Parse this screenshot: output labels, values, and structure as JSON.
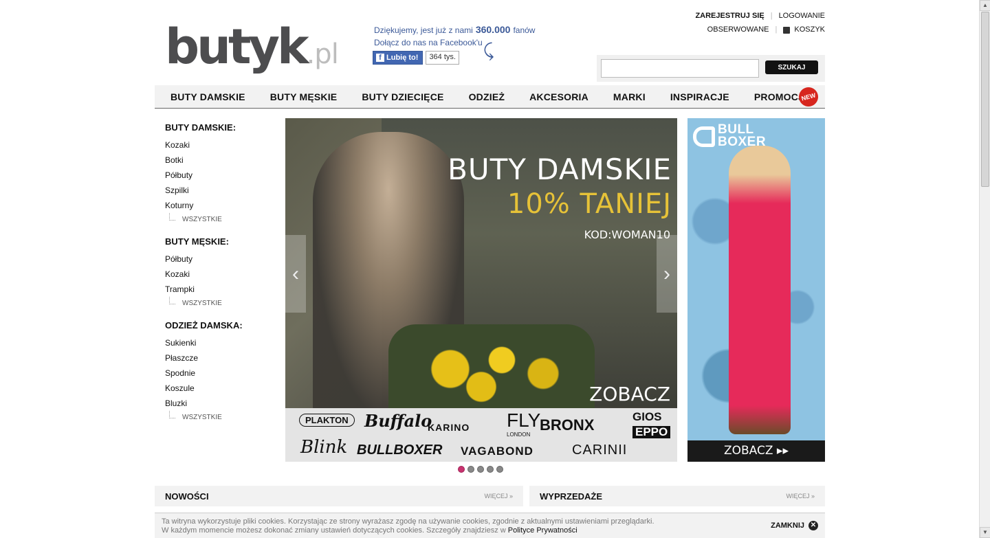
{
  "logo": {
    "main": "butyk",
    "suffix": ".pl"
  },
  "facebook": {
    "line1_pre": "Dziękujemy, jest już z nami",
    "count": "360.000",
    "line1_post": "fanów",
    "line2": "Dołącz do nas na Facebook'u",
    "like_label": "Lubię to!",
    "like_count": "364 tys."
  },
  "toplinks": {
    "register": "ZAREJESTRUJ SIĘ",
    "login": "LOGOWANIE",
    "watched": "OBSERWOWANE",
    "cart": "KOSZYK"
  },
  "search": {
    "button": "SZUKAJ",
    "value": ""
  },
  "mainnav": {
    "items": [
      "BUTY DAMSKIE",
      "BUTY MĘSKIE",
      "BUTY DZIECIĘCE",
      "ODZIEŻ",
      "AKCESORIA",
      "MARKI",
      "INSPIRACJE",
      "PROMOCJE"
    ],
    "new_badge": "NEW"
  },
  "sidebar": {
    "groups": [
      {
        "title": "BUTY DAMSKIE:",
        "items": [
          "Kozaki",
          "Botki",
          "Półbuty",
          "Szpilki",
          "Koturny"
        ],
        "all": "WSZYSTKIE"
      },
      {
        "title": "BUTY MĘSKIE:",
        "items": [
          "Półbuty",
          "Kozaki",
          "Trampki"
        ],
        "all": "WSZYSTKIE"
      },
      {
        "title": "ODZIEŻ DAMSKA:",
        "items": [
          "Sukienki",
          "Płaszcze",
          "Spodnie",
          "Koszule",
          "Bluzki"
        ],
        "all": "WSZYSTKIE"
      }
    ]
  },
  "slider": {
    "headline": "BUTY DAMSKIE",
    "discount": "10% TANIEJ",
    "code": "KOD:WOMAN10",
    "cta": "ZOBACZ",
    "brands": [
      "PLAKTON",
      "Buffalo",
      "KARINO",
      "FLY",
      "LONDON",
      "BRONX",
      "GIOS",
      "EPPO",
      "Blink",
      "BULLBOXER",
      "VAGABOND",
      "CARINII"
    ],
    "slides_total": 5,
    "active_slide": 1
  },
  "banner": {
    "brand_line1": "BULL",
    "brand_line2": "BOXER",
    "cta": "ZOBACZ ▸▸"
  },
  "sections": {
    "left": {
      "title": "NOWOŚCI",
      "more": "WIĘCEJ »"
    },
    "right": {
      "title": "WYPRZEDAŻE",
      "more": "WIĘCEJ »"
    }
  },
  "cookie": {
    "line1": "Ta witryna wykorzystuje pliki cookies. Korzystając ze strony wyrażasz zgodę na używanie cookies, zgodnie z aktualnymi ustawieniami przeglądarki.",
    "line2": "W każdym momencie możesz dokonać zmiany ustawień dotyczących cookies. Szczegóły znajdziesz w",
    "link": "Polityce Prywatności",
    "close": "ZAMKNIJ"
  },
  "colors": {
    "accent": "#c8336f",
    "facebook": "#3b5998",
    "banner_bg": "#8ec3e2",
    "headline_yellow": "#e6c238"
  }
}
